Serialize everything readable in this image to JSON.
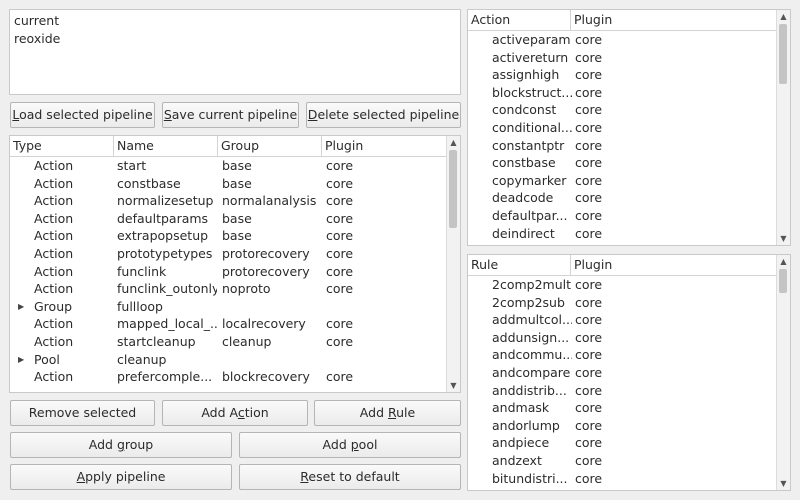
{
  "pipelines": [
    "current",
    "reoxide"
  ],
  "buttons": {
    "load": {
      "pre": "",
      "mn": "L",
      "post": "oad selected pipeline"
    },
    "save": {
      "pre": "",
      "mn": "S",
      "post": "ave current pipeline"
    },
    "delete": {
      "pre": "",
      "mn": "D",
      "post": "elete selected pipeline"
    },
    "remove": {
      "pre": "Remove selected",
      "mn": "",
      "post": ""
    },
    "add_action": {
      "pre": "Add A",
      "mn": "c",
      "post": "tion"
    },
    "add_rule": {
      "pre": "Add ",
      "mn": "R",
      "post": "ule"
    },
    "add_group": {
      "pre": "Add ",
      "mn": "g",
      "post": "roup"
    },
    "add_pool": {
      "pre": "Add ",
      "mn": "p",
      "post": "ool"
    },
    "apply": {
      "pre": "",
      "mn": "A",
      "post": "pply pipeline"
    },
    "reset": {
      "pre": "",
      "mn": "R",
      "post": "eset to default"
    }
  },
  "pipeline_table": {
    "headers": [
      "Type",
      "Name",
      "Group",
      "Plugin"
    ],
    "rows": [
      {
        "type": "Action",
        "name": "start",
        "group": "base",
        "plugin": "core",
        "expandable": false
      },
      {
        "type": "Action",
        "name": "constbase",
        "group": "base",
        "plugin": "core",
        "expandable": false
      },
      {
        "type": "Action",
        "name": "normalizesetup",
        "group": "normalanalysis",
        "plugin": "core",
        "expandable": false
      },
      {
        "type": "Action",
        "name": "defaultparams",
        "group": "base",
        "plugin": "core",
        "expandable": false
      },
      {
        "type": "Action",
        "name": "extrapopsetup",
        "group": "base",
        "plugin": "core",
        "expandable": false
      },
      {
        "type": "Action",
        "name": "prototypetypes",
        "group": "protorecovery",
        "plugin": "core",
        "expandable": false
      },
      {
        "type": "Action",
        "name": "funclink",
        "group": "protorecovery",
        "plugin": "core",
        "expandable": false
      },
      {
        "type": "Action",
        "name": "funclink_outonly",
        "group": "noproto",
        "plugin": "core",
        "expandable": false
      },
      {
        "type": "Group",
        "name": "fullloop",
        "group": "",
        "plugin": "",
        "expandable": true
      },
      {
        "type": "Action",
        "name": "mapped_local_...",
        "group": "localrecovery",
        "plugin": "core",
        "expandable": false
      },
      {
        "type": "Action",
        "name": "startcleanup",
        "group": "cleanup",
        "plugin": "core",
        "expandable": false
      },
      {
        "type": "Pool",
        "name": "cleanup",
        "group": "",
        "plugin": "",
        "expandable": true
      },
      {
        "type": "Action",
        "name": "prefercomple...",
        "group": "blockrecovery",
        "plugin": "core",
        "expandable": false
      }
    ]
  },
  "action_table": {
    "headers": [
      "Action",
      "Plugin"
    ],
    "rows": [
      {
        "name": "activeparam",
        "plugin": "core"
      },
      {
        "name": "activereturn",
        "plugin": "core"
      },
      {
        "name": "assignhigh",
        "plugin": "core"
      },
      {
        "name": "blockstruct...",
        "plugin": "core"
      },
      {
        "name": "condconst",
        "plugin": "core"
      },
      {
        "name": "conditional...",
        "plugin": "core"
      },
      {
        "name": "constantptr",
        "plugin": "core"
      },
      {
        "name": "constbase",
        "plugin": "core"
      },
      {
        "name": "copymarker",
        "plugin": "core"
      },
      {
        "name": "deadcode",
        "plugin": "core"
      },
      {
        "name": "defaultpar...",
        "plugin": "core"
      },
      {
        "name": "deindirect",
        "plugin": "core"
      }
    ]
  },
  "rule_table": {
    "headers": [
      "Rule",
      "Plugin"
    ],
    "rows": [
      {
        "name": "2comp2mult",
        "plugin": "core"
      },
      {
        "name": "2comp2sub",
        "plugin": "core"
      },
      {
        "name": "addmultcol...",
        "plugin": "core"
      },
      {
        "name": "addunsign...",
        "plugin": "core"
      },
      {
        "name": "andcommu...",
        "plugin": "core"
      },
      {
        "name": "andcompare",
        "plugin": "core"
      },
      {
        "name": "anddistrib...",
        "plugin": "core"
      },
      {
        "name": "andmask",
        "plugin": "core"
      },
      {
        "name": "andorlump",
        "plugin": "core"
      },
      {
        "name": "andpiece",
        "plugin": "core"
      },
      {
        "name": "andzext",
        "plugin": "core"
      },
      {
        "name": "bitundistri...",
        "plugin": "core"
      }
    ]
  }
}
